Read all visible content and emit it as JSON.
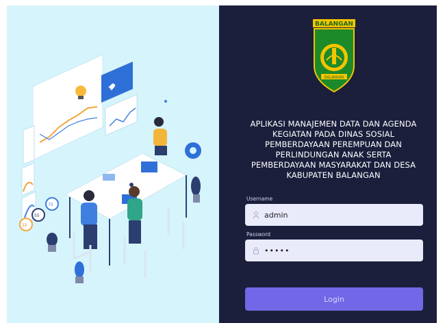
{
  "branding": {
    "logo_text_top": "BALANGAN",
    "logo_text_bottom": "BALANGAN",
    "app_title_lines": [
      "APLIKASI MANAJEMEN DATA DAN AGENDA",
      "KEGIATAN PADA DINAS SOSIAL",
      "PEMBERDAYAAN PEREMPUAN DAN",
      "PERLINDUNGAN ANAK SERTA",
      "PEMBERDAYAAN MASYARAKAT DAN DESA",
      "KABUPATEN BALANGAN"
    ]
  },
  "form": {
    "username_label": "Username",
    "username_value": "admin",
    "password_label": "Password",
    "password_value": "•••••",
    "login_label": "Login"
  },
  "illustration": {
    "gauge_values": [
      "32",
      "55",
      "75"
    ]
  },
  "colors": {
    "panel_bg": "#1b1f3c",
    "illustration_bg": "#d6f4fb",
    "input_bg": "#e9ebfb",
    "button_bg": "#7267e6",
    "accent_blue": "#2f6fd8"
  },
  "icons": {
    "username_icon": "user-icon",
    "password_icon": "lock-icon"
  }
}
